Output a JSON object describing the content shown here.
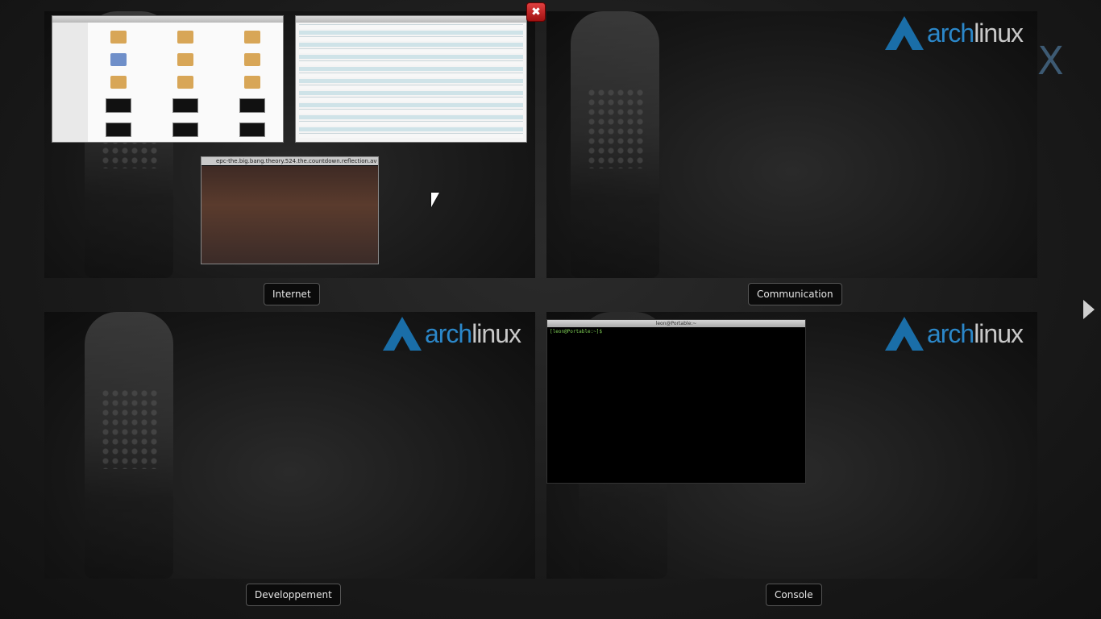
{
  "workspaces": [
    {
      "label": "Internet"
    },
    {
      "label": "Communication"
    },
    {
      "label": "Developpement"
    },
    {
      "label": "Console"
    }
  ],
  "logo": {
    "prefix": "arch",
    "suffix": "linux"
  },
  "windows": {
    "video_title": "epc-the.big.bang.theory.524.the.countdown.reflection.av",
    "terminal_title": "leon@Portable:~",
    "terminal_prompt": "[leon@Portable:~]$"
  },
  "controls": {
    "close_glyph": "✖",
    "bg_x_glyph": "X"
  }
}
